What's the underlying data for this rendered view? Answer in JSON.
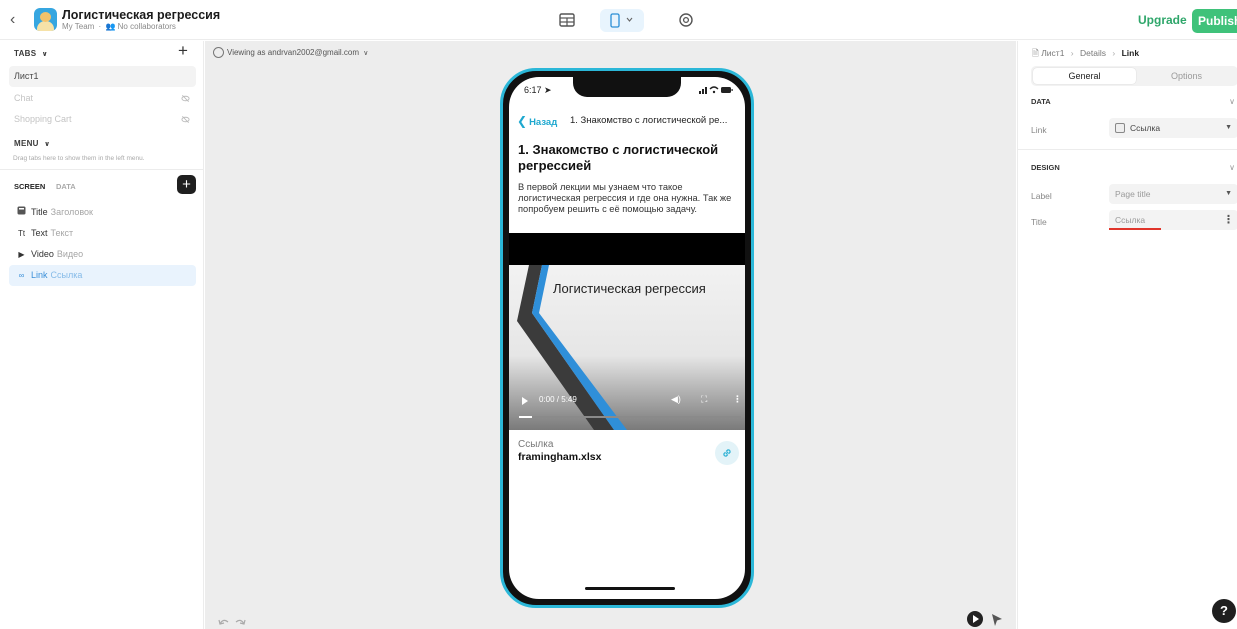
{
  "topbar": {
    "app_title": "Логистическая регрессия",
    "team": "My Team",
    "collaborators": "No collaborators",
    "upgrade_label": "Upgrade",
    "publish_label": "Publish"
  },
  "left_panel": {
    "tabs_label": "TABS",
    "tabs": [
      {
        "label": "Лист1",
        "state": "active"
      },
      {
        "label": "Chat",
        "state": "hidden"
      },
      {
        "label": "Shopping Cart",
        "state": "hidden"
      }
    ],
    "menu_label": "MENU",
    "menu_hint": "Drag tabs here to show them in the left menu.",
    "screen_tab": "SCREEN",
    "data_tab": "DATA",
    "components": [
      {
        "icon": "title-icon",
        "type": "Title",
        "value": "Заголовок"
      },
      {
        "icon": "text-icon",
        "type": "Text",
        "value": "Текст"
      },
      {
        "icon": "video-icon",
        "type": "Video",
        "value": "Видео"
      },
      {
        "icon": "link-icon",
        "type": "Link",
        "value": "Ссылка",
        "selected": true
      }
    ]
  },
  "canvas": {
    "viewing_as": "Viewing as andrvan2002@gmail.com"
  },
  "phone": {
    "time": "6:17",
    "back_label": "Назад",
    "nav_title": "1. Знакомство с логистической ре...",
    "screen_title": "1. Знакомство с логистической регрессией",
    "screen_text": "В первой лекции мы узнаем что такое логистическая регрессия и где она нужна. Так же попробуем решить с её помощью задачу.",
    "video": {
      "caption": "Логистическая регрессия",
      "time": "0:00 / 5:49",
      "progress": 0.06
    },
    "link": {
      "label": "Ссылка",
      "file": "framingham.xlsx"
    }
  },
  "right_panel": {
    "breadcrumb": [
      "Лист1",
      "Details",
      "Link"
    ],
    "segments": {
      "general": "General",
      "options": "Options"
    },
    "data_section": "DATA",
    "link_prop": "Link",
    "link_value": "Ссылка",
    "design_section": "DESIGN",
    "label_prop": "Label",
    "label_value": "Page title",
    "title_prop": "Title",
    "title_value": "Ссылка"
  },
  "colors": {
    "accent": "#1ea8cf",
    "publish": "#3fc27a",
    "upgrade": "#2ea66a",
    "selection": "#e9f3fd",
    "phone_frame": "#2bb7d8"
  }
}
